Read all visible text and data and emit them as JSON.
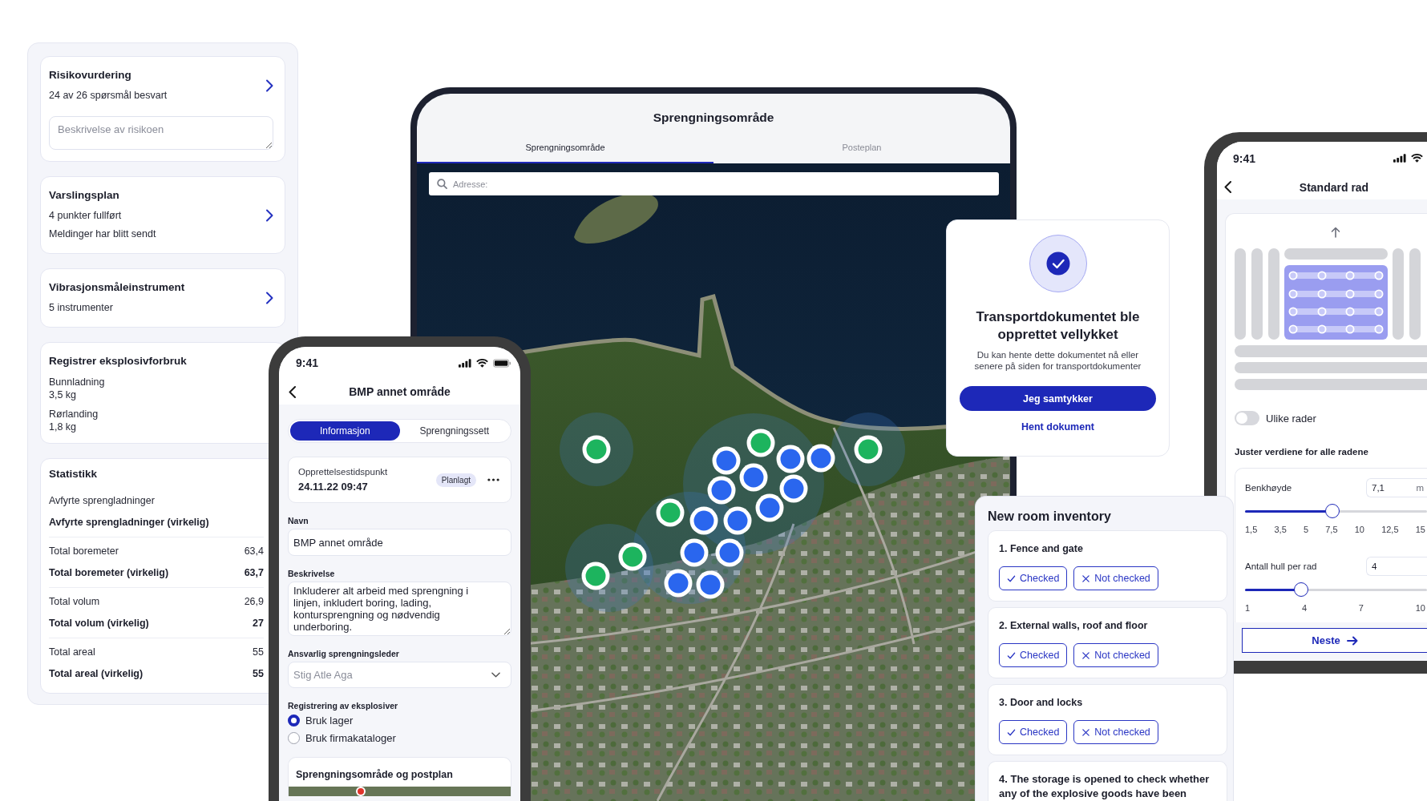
{
  "side_panel": {
    "cards": [
      {
        "kind": "risk",
        "title": "Risikovurdering",
        "lines": [
          "24 av 26 spørsmål besvart"
        ],
        "placeholder": "Beskrivelse av risikoen"
      },
      {
        "kind": "summary",
        "title": "Varslingsplan",
        "lines": [
          "4 punkter fullført",
          "Meldinger har blitt sendt"
        ]
      },
      {
        "kind": "summary",
        "title": "Vibrasjonsmåleinstrument",
        "lines": [
          "5 instrumenter"
        ]
      },
      {
        "kind": "usage",
        "title": "Registrer eksplosivforbruk",
        "items": [
          {
            "label": "Bunnladning",
            "value": "3,5 kg"
          },
          {
            "label": "Rørlanding",
            "value": "1,8 kg"
          }
        ]
      }
    ],
    "statistics": {
      "title": "Statistikk",
      "groups": [
        {
          "rows": [
            {
              "kind": "planned",
              "label": "Avfyrte sprengladninger"
            },
            {
              "kind": "actual",
              "label": "Avfyrte sprengladninger (virkelig)"
            }
          ]
        },
        {
          "rows": [
            {
              "kind": "planned",
              "label": "Total boremeter",
              "value": "63,4"
            },
            {
              "kind": "actual",
              "label": "Total boremeter (virkelig)",
              "value": "63,7"
            }
          ]
        },
        {
          "rows": [
            {
              "kind": "planned",
              "label": "Total volum",
              "value": "26,9"
            },
            {
              "kind": "actual",
              "label": "Total volum (virkelig)",
              "value": "27"
            }
          ]
        },
        {
          "rows": [
            {
              "kind": "planned",
              "label": "Total areal",
              "value": "55"
            },
            {
              "kind": "actual",
              "label": "Total areal (virkelig)",
              "value": "55"
            }
          ]
        }
      ]
    }
  },
  "tablet": {
    "title": "Sprengningsområde",
    "tabs": [
      {
        "label": "Sprengningsområde",
        "selected": true
      },
      {
        "label": "Posteplan",
        "selected": false
      }
    ],
    "search": {
      "placeholder": "Adresse:"
    },
    "map": {
      "markers": [
        {
          "color": "#1db45e"
        },
        {
          "color": "#1db45e"
        },
        {
          "color": "#1db45e"
        },
        {
          "color": "#1db45e"
        },
        {
          "color": "#1db45e"
        },
        {
          "color": "#1db45e"
        },
        {
          "color": "#2a66ee"
        },
        {
          "color": "#2a66ee"
        },
        {
          "color": "#2a66ee"
        },
        {
          "color": "#2a66ee"
        },
        {
          "color": "#2a66ee"
        },
        {
          "color": "#2a66ee"
        },
        {
          "color": "#2a66ee"
        },
        {
          "color": "#2a66ee"
        },
        {
          "color": "#2a66ee"
        },
        {
          "color": "#2a66ee"
        },
        {
          "color": "#2a66ee"
        },
        {
          "color": "#2a66ee"
        },
        {
          "color": "#2a66ee"
        }
      ]
    }
  },
  "phone_form": {
    "status_time": "9:41",
    "title": "BMP annet område",
    "segments": [
      {
        "label": "Informasjon",
        "selected": true
      },
      {
        "label": "Sprengningssett",
        "selected": false
      }
    ],
    "created": {
      "label": "Opprettelsestidspunkt",
      "value": "24.11.22 09:47",
      "badge": "Planlagt"
    },
    "fields": [
      {
        "kind": "input",
        "label": "Navn",
        "value": "BMP annet område"
      },
      {
        "kind": "textarea",
        "label": "Beskrivelse",
        "value": "Inkluderer alt arbeid med sprengning i linjen, inkludert boring, lading, kontursprengning og nødvendig underboring."
      },
      {
        "kind": "select",
        "label": "Ansvarlig sprengningsleder",
        "placeholder": "Stig Atle Aga"
      }
    ],
    "explosives": {
      "label": "Registrering av eksplosiver",
      "options": [
        {
          "label": "Bruk lager",
          "selected": true
        },
        {
          "label": "Bruk firmakataloger",
          "selected": false
        }
      ]
    },
    "map_card": {
      "title": "Sprengningsområde og postplan"
    }
  },
  "success_dialog": {
    "title": "Transportdokumentet ble opprettet vellykket",
    "message": "Du kan hente dette dokumentet nå eller senere på siden for transportdokumenter",
    "primary_button": "Jeg samtykker",
    "link": "Hent dokument"
  },
  "inventory": {
    "title": "New room inventory",
    "items": [
      {
        "title": "1. Fence and gate",
        "options": [
          {
            "kind": "check",
            "label": "Checked",
            "selected": false
          },
          {
            "kind": "cross",
            "label": "Not checked",
            "selected": false
          }
        ]
      },
      {
        "title": "2. External walls, roof and floor",
        "options": [
          {
            "kind": "check",
            "label": "Checked",
            "selected": false
          },
          {
            "kind": "cross",
            "label": "Not checked",
            "selected": false
          }
        ]
      },
      {
        "title": "3. Door and locks",
        "options": [
          {
            "kind": "check",
            "label": "Checked",
            "selected": false
          },
          {
            "kind": "cross",
            "label": "Not checked",
            "selected": false
          }
        ]
      },
      {
        "title": "4. The storage is opened to check whether any of the explosive goods have been"
      }
    ]
  },
  "phone_rows": {
    "status_time": "9:41",
    "title": "Standard rad",
    "toggle": {
      "label": "Ulike rader",
      "on": false
    },
    "section_title": "Juster verdiene for alle radene",
    "sliders": [
      {
        "label": "Benkhøyde",
        "value": "7,1",
        "unit": "m",
        "level": 0.48,
        "ticks": [
          "1,5",
          "3,5",
          "5",
          "7,5",
          "10",
          "12,5",
          "15"
        ]
      },
      {
        "label": "Antall hull per rad",
        "value": "4",
        "level": 0.31,
        "ticks": [
          "1",
          "4",
          "7",
          "10"
        ]
      }
    ],
    "next_button": "Neste"
  }
}
